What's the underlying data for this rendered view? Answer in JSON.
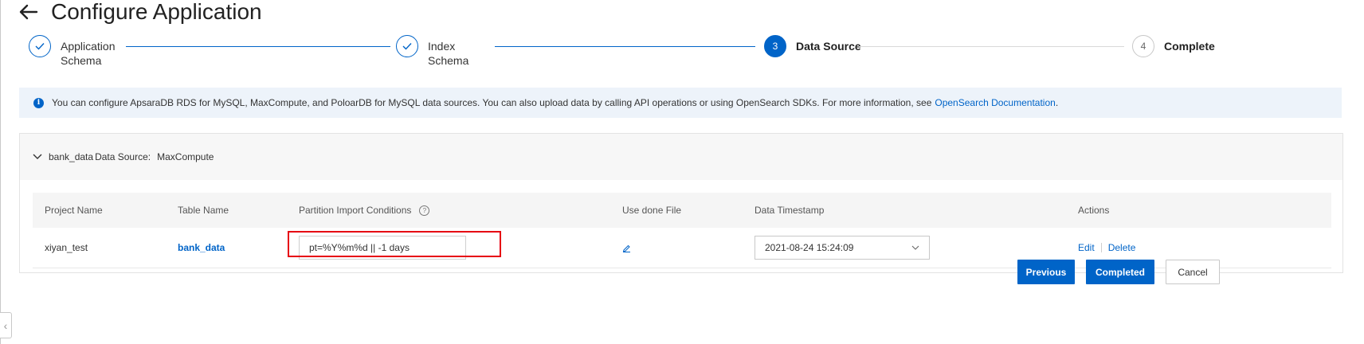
{
  "page": {
    "title": "Configure Application"
  },
  "stepper": {
    "steps": [
      {
        "label_line1": "Application",
        "label_line2": "Schema",
        "state": "done"
      },
      {
        "label_line1": "Index",
        "label_line2": "Schema",
        "state": "done"
      },
      {
        "number": "3",
        "label": "Data Source",
        "state": "active"
      },
      {
        "number": "4",
        "label": "Complete",
        "state": "todo"
      }
    ]
  },
  "info": {
    "text": "You can configure ApsaraDB RDS for MySQL, MaxCompute, and PoloarDB for MySQL data sources. You can also upload data by calling API operations or using OpenSearch SDKs. For more information, see",
    "link": "OpenSearch Documentation",
    "suffix": "."
  },
  "panel": {
    "name": "bank_data",
    "source_label": "Data Source:",
    "source_value": "MaxCompute",
    "columns": {
      "project": "Project Name",
      "table": "Table Name",
      "partition": "Partition Import Conditions",
      "done_file": "Use done File",
      "timestamp": "Data Timestamp",
      "actions": "Actions"
    },
    "row": {
      "project": "xiyan_test",
      "table": "bank_data",
      "partition": "pt=%Y%m%d || -1 days",
      "timestamp": "2021-08-24 15:24:09",
      "edit": "Edit",
      "delete": "Delete"
    }
  },
  "buttons": {
    "previous": "Previous",
    "completed": "Completed",
    "cancel": "Cancel"
  },
  "colors": {
    "primary": "#0064c8",
    "highlight": "#e60012",
    "banner": "#edf3fa"
  }
}
